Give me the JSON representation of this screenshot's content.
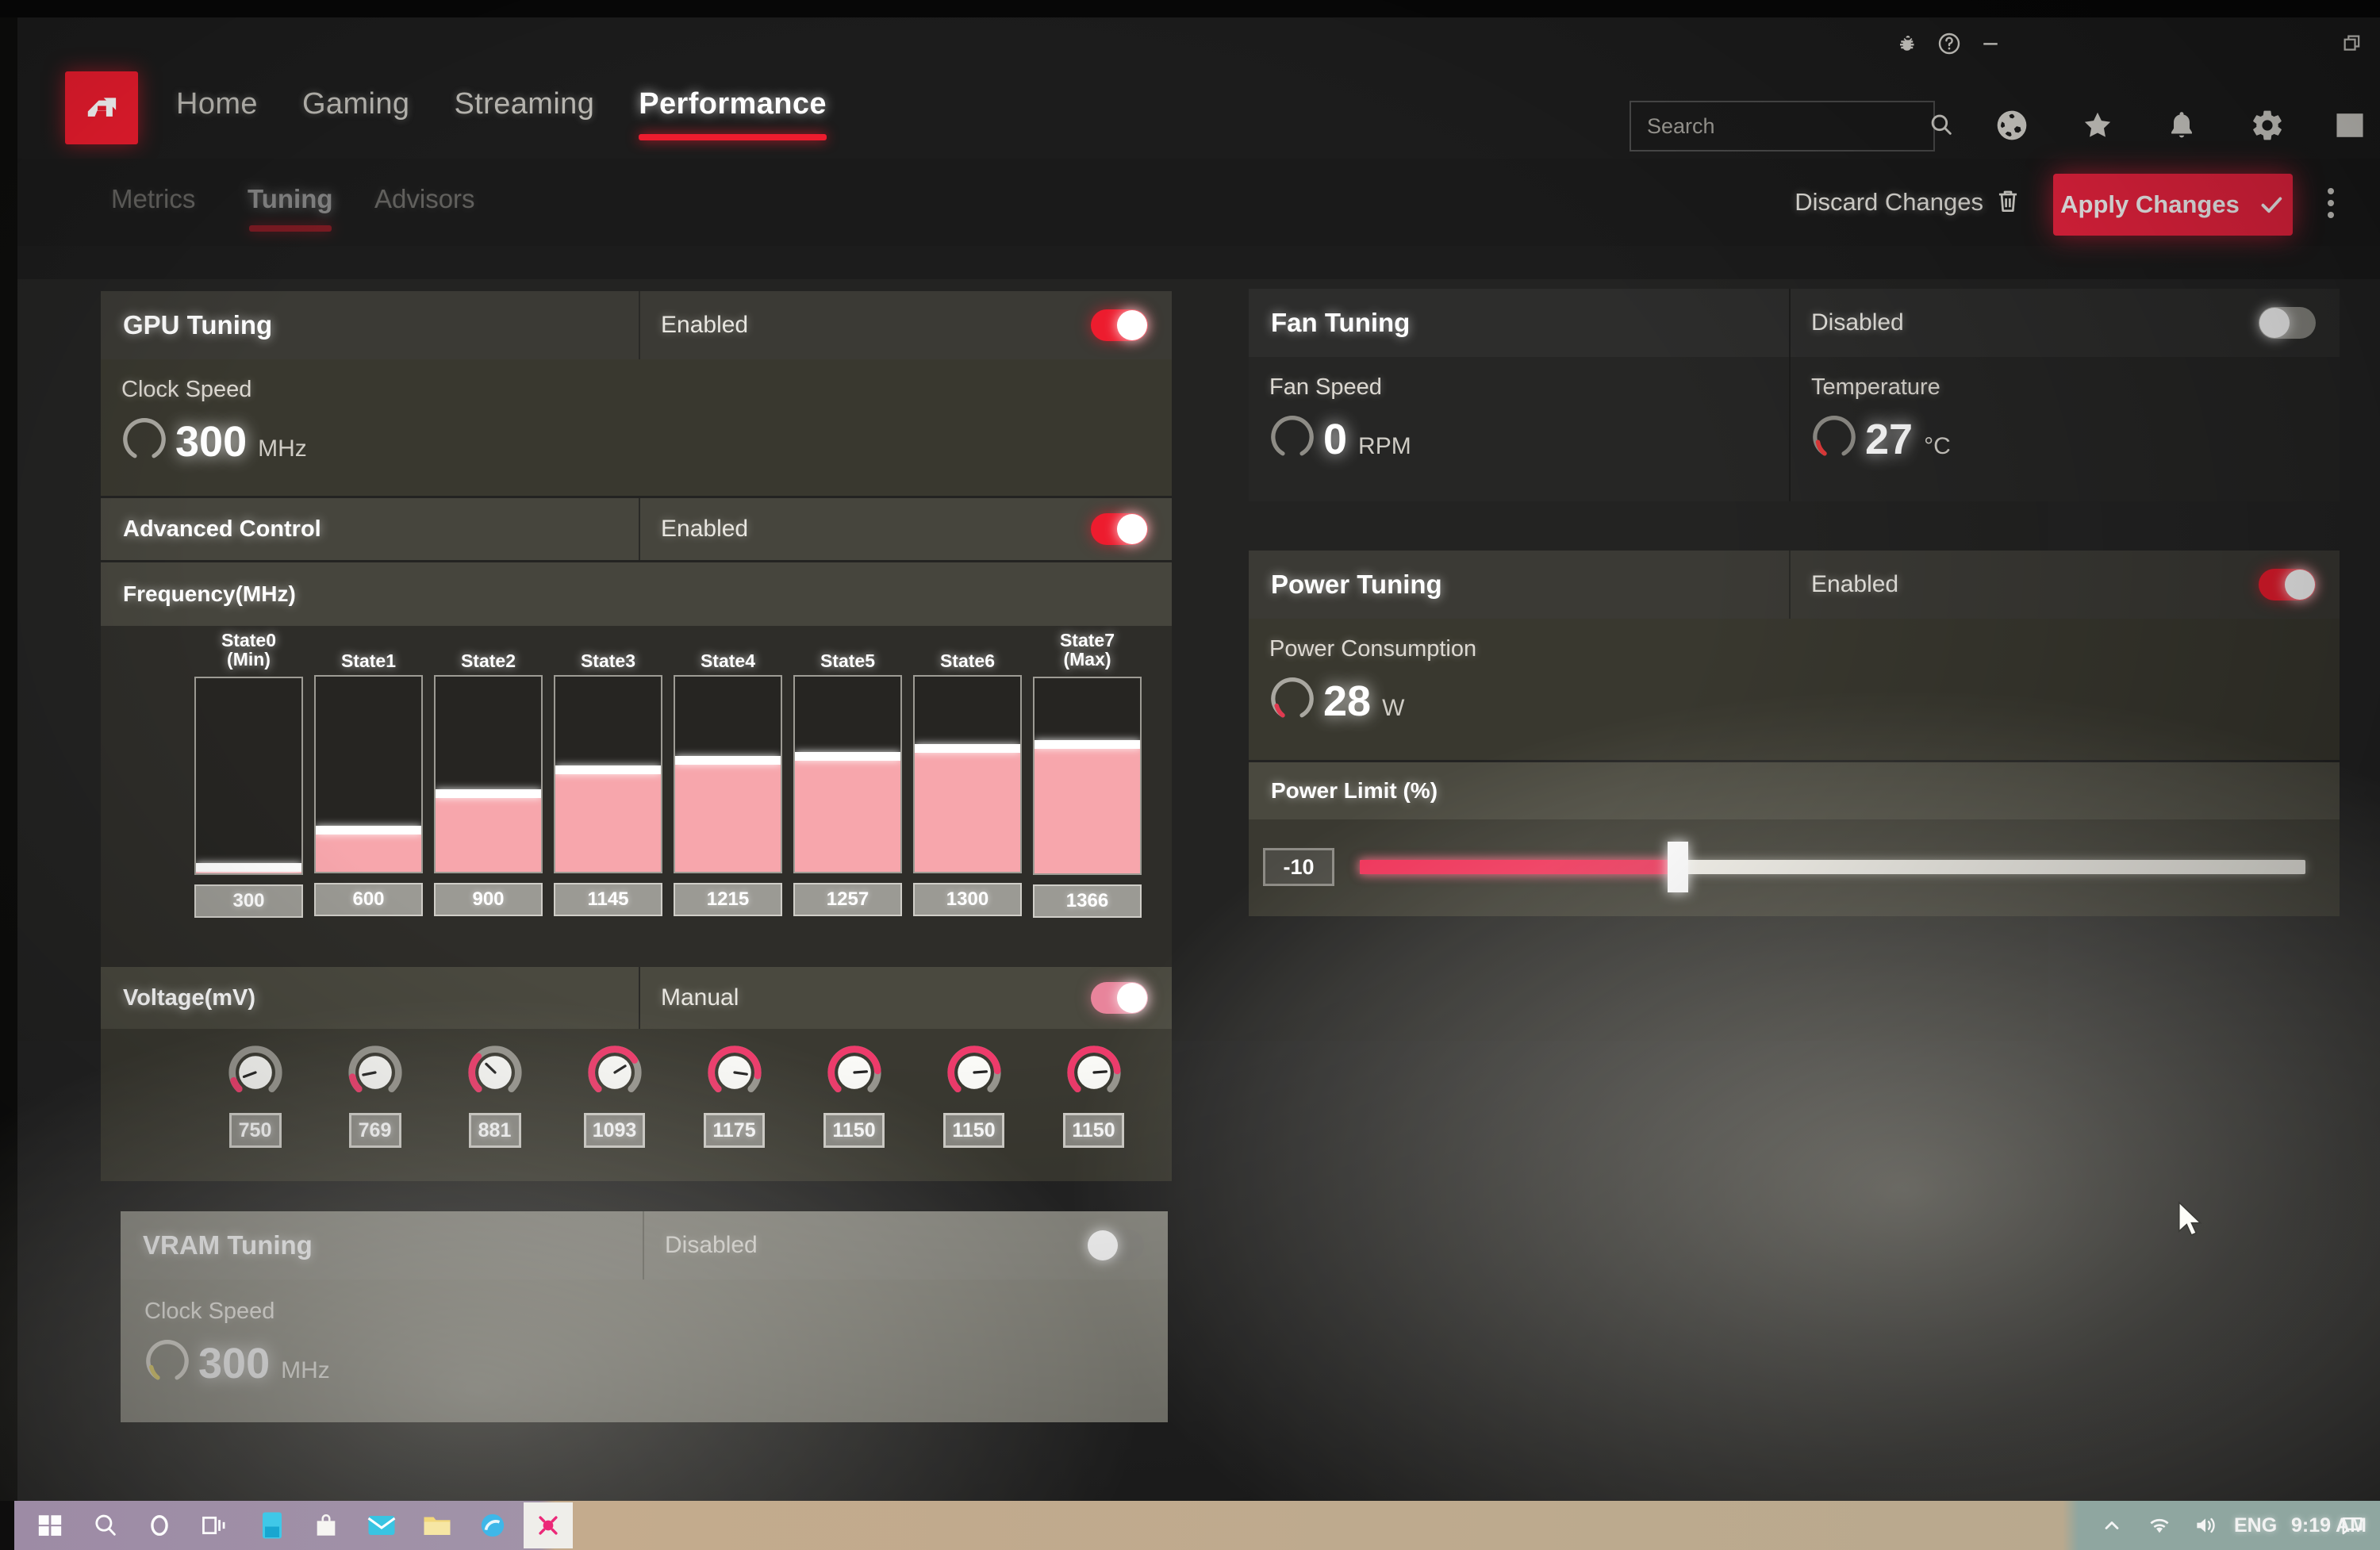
{
  "window": {
    "title_icons": [
      "bug-icon",
      "help-icon",
      "minimize-icon",
      "restore-icon"
    ]
  },
  "header": {
    "logo": "amd-logo",
    "nav": [
      {
        "label": "Home",
        "active": false
      },
      {
        "label": "Gaming",
        "active": false
      },
      {
        "label": "Streaming",
        "active": false
      },
      {
        "label": "Performance",
        "active": true
      }
    ],
    "search": {
      "value": "",
      "placeholder": "Search"
    },
    "icons": [
      "globe-icon",
      "star-icon",
      "bell-icon",
      "gear-icon",
      "collapse-panel-icon"
    ]
  },
  "subnav": {
    "tabs": [
      {
        "label": "Metrics",
        "active": false
      },
      {
        "label": "Tuning",
        "active": true
      },
      {
        "label": "Advisors",
        "active": false
      }
    ],
    "discard_label": "Discard Changes",
    "apply_label": "Apply Changes"
  },
  "gpu_tuning": {
    "title": "GPU Tuning",
    "state": "Enabled",
    "enabled": true,
    "clock_speed": {
      "label": "Clock Speed",
      "value": "300",
      "unit": "MHz"
    },
    "advanced_control": {
      "label": "Advanced Control",
      "state": "Enabled",
      "enabled": true
    },
    "frequency": {
      "label": "Frequency(MHz)",
      "states": [
        {
          "name": "State0",
          "sub": "(Min)",
          "value": "300"
        },
        {
          "name": "State1",
          "sub": "",
          "value": "600"
        },
        {
          "name": "State2",
          "sub": "",
          "value": "900"
        },
        {
          "name": "State3",
          "sub": "",
          "value": "1145"
        },
        {
          "name": "State4",
          "sub": "",
          "value": "1215"
        },
        {
          "name": "State5",
          "sub": "",
          "value": "1257"
        },
        {
          "name": "State6",
          "sub": "",
          "value": "1300"
        },
        {
          "name": "State7",
          "sub": "(Max)",
          "value": "1366"
        }
      ]
    },
    "voltage": {
      "label": "Voltage(mV)",
      "mode": "Manual",
      "mode_enabled": true,
      "values": [
        "750",
        "769",
        "881",
        "1093",
        "1175",
        "1150",
        "1150",
        "1150"
      ]
    }
  },
  "vram_tuning": {
    "title": "VRAM Tuning",
    "state": "Disabled",
    "enabled": false,
    "clock_speed": {
      "label": "Clock Speed",
      "value": "300",
      "unit": "MHz"
    }
  },
  "fan_tuning": {
    "title": "Fan Tuning",
    "state": "Disabled",
    "enabled": false,
    "fan_speed": {
      "label": "Fan Speed",
      "value": "0",
      "unit": "RPM"
    },
    "temperature": {
      "label": "Temperature",
      "value": "27",
      "unit": "°C"
    }
  },
  "power_tuning": {
    "title": "Power Tuning",
    "state": "Enabled",
    "enabled": true,
    "power_consumption": {
      "label": "Power Consumption",
      "value": "28",
      "unit": "W"
    },
    "power_limit": {
      "label": "Power Limit (%)",
      "value": "-10"
    }
  },
  "taskbar": {
    "items": [
      "start-icon",
      "search-icon",
      "cortana-icon",
      "task-view-icon",
      "store-icon",
      "bag-icon",
      "mail-icon",
      "file-explorer-icon",
      "browser-icon",
      "amd-software-icon"
    ],
    "tray": {
      "overflow": "^",
      "wifi": "wifi-icon",
      "volume": "volume-icon",
      "lang": "ENG",
      "time": "9:19 AM",
      "notify": "notification-icon"
    }
  },
  "colors": {
    "accent_red": "#ed1c2e",
    "apply_red": "#f32441",
    "bar_pink": "#f7a6ac",
    "card_header": "#3b3a35",
    "card_body": "#39382f"
  },
  "chart_data": {
    "type": "bar",
    "title": "Frequency(MHz)",
    "categories": [
      "State0 (Min)",
      "State1",
      "State2",
      "State3",
      "State4",
      "State5",
      "State6",
      "State7 (Max)"
    ],
    "values": [
      300,
      600,
      900,
      1145,
      1215,
      1257,
      1300,
      1366
    ],
    "fill_percent": [
      3,
      21,
      40,
      52,
      57,
      59,
      63,
      66
    ],
    "xlabel": "",
    "ylabel": "MHz",
    "ylim": [
      200,
      2000
    ],
    "grid": false,
    "legend": "none"
  }
}
